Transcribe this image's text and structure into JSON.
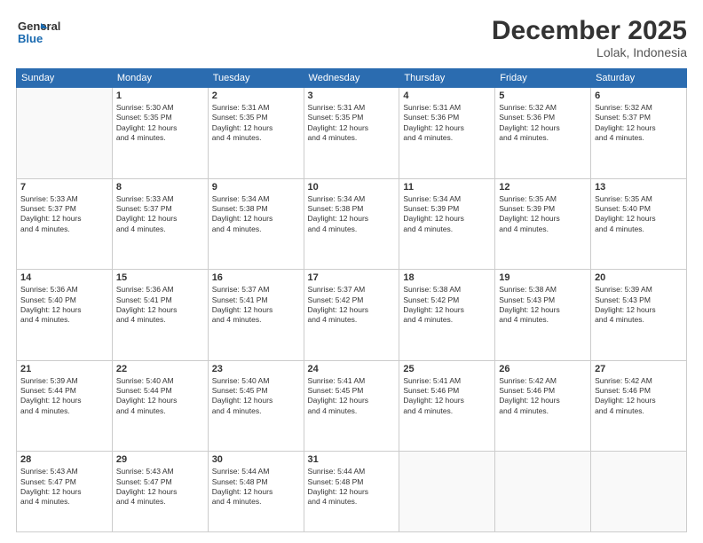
{
  "header": {
    "logo_line1": "General",
    "logo_line2": "Blue",
    "month": "December 2025",
    "location": "Lolak, Indonesia"
  },
  "days_of_week": [
    "Sunday",
    "Monday",
    "Tuesday",
    "Wednesday",
    "Thursday",
    "Friday",
    "Saturday"
  ],
  "weeks": [
    [
      {
        "day": "",
        "content": ""
      },
      {
        "day": "1",
        "content": "Sunrise: 5:30 AM\nSunset: 5:35 PM\nDaylight: 12 hours\nand 4 minutes."
      },
      {
        "day": "2",
        "content": "Sunrise: 5:31 AM\nSunset: 5:35 PM\nDaylight: 12 hours\nand 4 minutes."
      },
      {
        "day": "3",
        "content": "Sunrise: 5:31 AM\nSunset: 5:35 PM\nDaylight: 12 hours\nand 4 minutes."
      },
      {
        "day": "4",
        "content": "Sunrise: 5:31 AM\nSunset: 5:36 PM\nDaylight: 12 hours\nand 4 minutes."
      },
      {
        "day": "5",
        "content": "Sunrise: 5:32 AM\nSunset: 5:36 PM\nDaylight: 12 hours\nand 4 minutes."
      },
      {
        "day": "6",
        "content": "Sunrise: 5:32 AM\nSunset: 5:37 PM\nDaylight: 12 hours\nand 4 minutes."
      }
    ],
    [
      {
        "day": "7",
        "content": "Sunrise: 5:33 AM\nSunset: 5:37 PM\nDaylight: 12 hours\nand 4 minutes."
      },
      {
        "day": "8",
        "content": "Sunrise: 5:33 AM\nSunset: 5:37 PM\nDaylight: 12 hours\nand 4 minutes."
      },
      {
        "day": "9",
        "content": "Sunrise: 5:34 AM\nSunset: 5:38 PM\nDaylight: 12 hours\nand 4 minutes."
      },
      {
        "day": "10",
        "content": "Sunrise: 5:34 AM\nSunset: 5:38 PM\nDaylight: 12 hours\nand 4 minutes."
      },
      {
        "day": "11",
        "content": "Sunrise: 5:34 AM\nSunset: 5:39 PM\nDaylight: 12 hours\nand 4 minutes."
      },
      {
        "day": "12",
        "content": "Sunrise: 5:35 AM\nSunset: 5:39 PM\nDaylight: 12 hours\nand 4 minutes."
      },
      {
        "day": "13",
        "content": "Sunrise: 5:35 AM\nSunset: 5:40 PM\nDaylight: 12 hours\nand 4 minutes."
      }
    ],
    [
      {
        "day": "14",
        "content": "Sunrise: 5:36 AM\nSunset: 5:40 PM\nDaylight: 12 hours\nand 4 minutes."
      },
      {
        "day": "15",
        "content": "Sunrise: 5:36 AM\nSunset: 5:41 PM\nDaylight: 12 hours\nand 4 minutes."
      },
      {
        "day": "16",
        "content": "Sunrise: 5:37 AM\nSunset: 5:41 PM\nDaylight: 12 hours\nand 4 minutes."
      },
      {
        "day": "17",
        "content": "Sunrise: 5:37 AM\nSunset: 5:42 PM\nDaylight: 12 hours\nand 4 minutes."
      },
      {
        "day": "18",
        "content": "Sunrise: 5:38 AM\nSunset: 5:42 PM\nDaylight: 12 hours\nand 4 minutes."
      },
      {
        "day": "19",
        "content": "Sunrise: 5:38 AM\nSunset: 5:43 PM\nDaylight: 12 hours\nand 4 minutes."
      },
      {
        "day": "20",
        "content": "Sunrise: 5:39 AM\nSunset: 5:43 PM\nDaylight: 12 hours\nand 4 minutes."
      }
    ],
    [
      {
        "day": "21",
        "content": "Sunrise: 5:39 AM\nSunset: 5:44 PM\nDaylight: 12 hours\nand 4 minutes."
      },
      {
        "day": "22",
        "content": "Sunrise: 5:40 AM\nSunset: 5:44 PM\nDaylight: 12 hours\nand 4 minutes."
      },
      {
        "day": "23",
        "content": "Sunrise: 5:40 AM\nSunset: 5:45 PM\nDaylight: 12 hours\nand 4 minutes."
      },
      {
        "day": "24",
        "content": "Sunrise: 5:41 AM\nSunset: 5:45 PM\nDaylight: 12 hours\nand 4 minutes."
      },
      {
        "day": "25",
        "content": "Sunrise: 5:41 AM\nSunset: 5:46 PM\nDaylight: 12 hours\nand 4 minutes."
      },
      {
        "day": "26",
        "content": "Sunrise: 5:42 AM\nSunset: 5:46 PM\nDaylight: 12 hours\nand 4 minutes."
      },
      {
        "day": "27",
        "content": "Sunrise: 5:42 AM\nSunset: 5:46 PM\nDaylight: 12 hours\nand 4 minutes."
      }
    ],
    [
      {
        "day": "28",
        "content": "Sunrise: 5:43 AM\nSunset: 5:47 PM\nDaylight: 12 hours\nand 4 minutes."
      },
      {
        "day": "29",
        "content": "Sunrise: 5:43 AM\nSunset: 5:47 PM\nDaylight: 12 hours\nand 4 minutes."
      },
      {
        "day": "30",
        "content": "Sunrise: 5:44 AM\nSunset: 5:48 PM\nDaylight: 12 hours\nand 4 minutes."
      },
      {
        "day": "31",
        "content": "Sunrise: 5:44 AM\nSunset: 5:48 PM\nDaylight: 12 hours\nand 4 minutes."
      },
      {
        "day": "",
        "content": ""
      },
      {
        "day": "",
        "content": ""
      },
      {
        "day": "",
        "content": ""
      }
    ]
  ]
}
